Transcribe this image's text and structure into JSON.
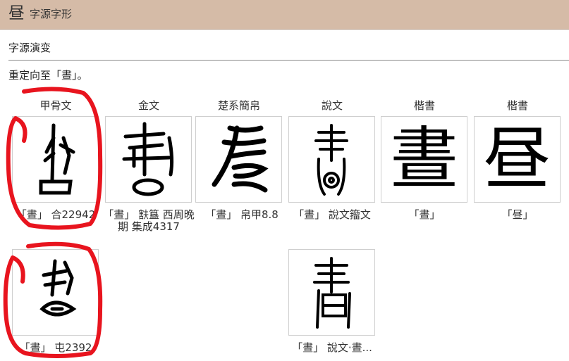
{
  "header": {
    "icon_char": "昼",
    "title": "字源字形"
  },
  "section": {
    "title": "字源演变"
  },
  "description": "重定向至「晝」。",
  "categories": [
    "甲骨文",
    "金文",
    "楚系簡帛",
    "說文",
    "楷書",
    "楷書"
  ],
  "items": [
    {
      "caption": "「晝」 合22942",
      "icon": "oracle-bone-glyph-icon"
    },
    {
      "caption": "「晝」 㝬簋 西周晚期 集成4317",
      "icon": "bronze-glyph-icon"
    },
    {
      "caption": "「晝」 帛甲8.8",
      "icon": "chu-slip-glyph-icon"
    },
    {
      "caption": "「晝」 說文籀文",
      "icon": "shuowen-glyph-icon"
    },
    {
      "caption": "「晝」",
      "glyph": "晝"
    },
    {
      "caption": "「昼」",
      "glyph": "昼"
    },
    {
      "caption": "「晝」 屯2392",
      "icon": "oracle-bone-glyph-icon"
    },
    {
      "caption": "「晝」 說文‧晝...",
      "icon": "shuowen-glyph-icon"
    }
  ],
  "colors": {
    "header_bg": "#d5bba7",
    "annotation": "#e8141e"
  }
}
